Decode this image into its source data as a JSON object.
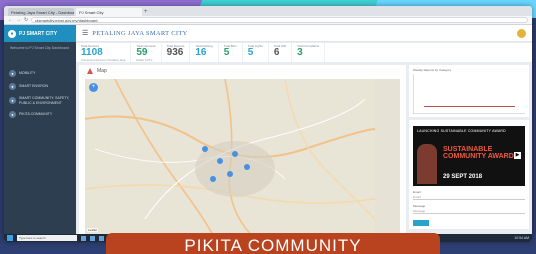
{
  "browser": {
    "tabs": [
      {
        "label": "Petaling Jaya Smart City - Dashboard"
      },
      {
        "label": "PJ Smart City"
      }
    ],
    "url": "pjsmartcity.mbpj.gov.my/dashboard"
  },
  "sidebar": {
    "brand": "PJ SMART CITY",
    "welcome": "Welcome to PJ Smart City Dashboard",
    "items": [
      {
        "label": "MOBILITY",
        "icon": "car-icon"
      },
      {
        "label": "SMART ENVIRON",
        "icon": "leaf-icon"
      },
      {
        "label": "SMART COMMUNITY, SAFETY, PUBLIC & ENVIRONMENT",
        "icon": "people-icon"
      },
      {
        "label": "PIKITA COMMUNITY",
        "icon": "community-icon"
      }
    ]
  },
  "header": {
    "title": "PETALING JAYA SMART CITY"
  },
  "stats": [
    {
      "label": "Total Sensors",
      "value": "1108",
      "sub": "Connected devices in Petaling Jaya"
    },
    {
      "label": "Total Cameras",
      "value": "59",
      "sub": "Public CCTV"
    },
    {
      "label": "Total Reports",
      "value": "936",
      "sub": ""
    },
    {
      "label": "Total Parking",
      "value": "16",
      "sub": ""
    },
    {
      "label": "Total Bins",
      "value": "5",
      "sub": ""
    },
    {
      "label": "Total Lights",
      "value": "5",
      "sub": ""
    },
    {
      "label": "Total Wifi",
      "value": "6",
      "sub": ""
    },
    {
      "label": "Total Complaints",
      "value": "3",
      "sub": ""
    }
  ],
  "map": {
    "title": "Map",
    "credit": "Leaflet"
  },
  "right": {
    "chart_title": "Weekly Reports by Category",
    "ad": {
      "header": "LAUNCHING SUSTAINABLE COMMUNITY AWARD",
      "headline": "SUSTAINABLE COMMUNITY AWARD",
      "date": "29 SEPT 2018"
    },
    "form": {
      "label1": "Email",
      "placeholder1": "Email",
      "label2": "Message",
      "placeholder2": "Message"
    }
  },
  "taskbar": {
    "search": "Type here to search",
    "time": "10:54 AM"
  },
  "caption": "PIKITA COMMUNITY"
}
